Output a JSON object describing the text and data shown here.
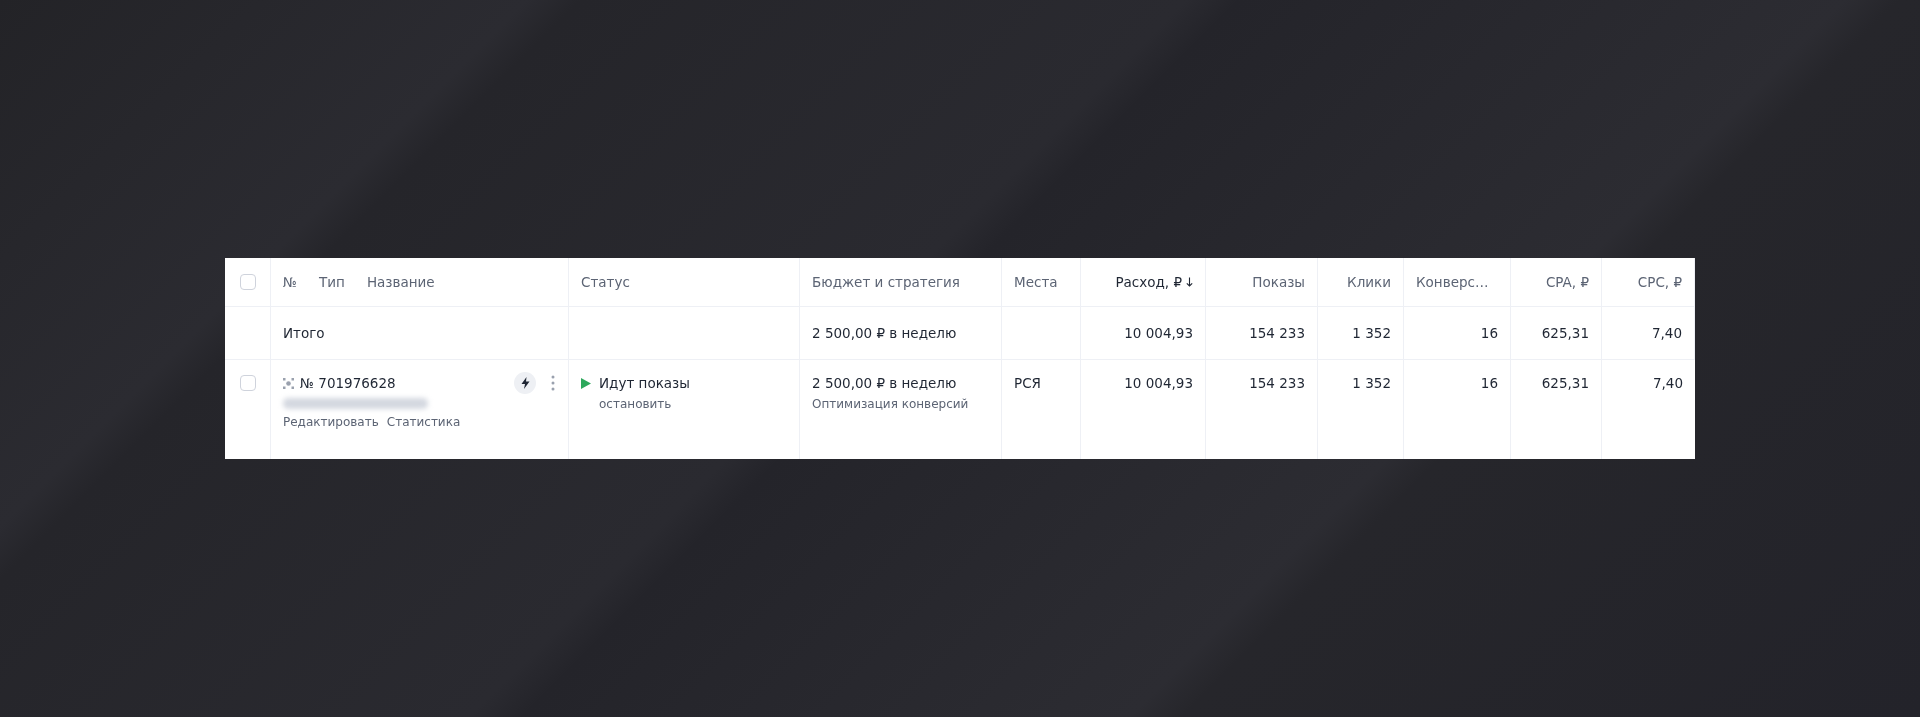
{
  "header": {
    "checkbox": {
      "checked": false
    },
    "columns": [
      {
        "kind": "name",
        "labels": [
          "№",
          "Тип",
          "Название"
        ]
      },
      {
        "kind": "text",
        "label": "Статус",
        "sorted": false
      },
      {
        "kind": "text",
        "label": "Бюджет и стратегия",
        "sorted": false
      },
      {
        "kind": "text",
        "label": "Места",
        "sorted": false
      },
      {
        "kind": "number",
        "label": "Расход, ₽",
        "sorted": true
      },
      {
        "kind": "number",
        "label": "Показы",
        "sorted": false
      },
      {
        "kind": "number",
        "label": "Клики",
        "sorted": false
      },
      {
        "kind": "text",
        "label": "Конверс…",
        "sorted": false
      },
      {
        "kind": "number",
        "label": "CPA, ₽",
        "sorted": false
      },
      {
        "kind": "number",
        "label": "CPC, ₽",
        "sorted": false
      }
    ]
  },
  "total_row": {
    "label": "Итого",
    "budget": "2 500,00 ₽ в неделю",
    "spend": "10 004,93",
    "shows": "154 233",
    "clicks": "1 352",
    "conversions": "16",
    "cpa": "625,31",
    "cpc": "7,40"
  },
  "campaigns": [
    {
      "checked": false,
      "number": "№ 701976628",
      "actions": [
        "Редактировать",
        "Статистика"
      ],
      "status": {
        "active": true,
        "label": "Идут показы",
        "action": "остановить"
      },
      "budget": "2 500,00 ₽ в неделю",
      "strategy": "Оптимизация конверсий",
      "places": "РСЯ",
      "spend": "10 004,93",
      "shows": "154 233",
      "clicks": "1 352",
      "conversions": "16",
      "cpa": "625,31",
      "cpc": "7,40"
    }
  ]
}
